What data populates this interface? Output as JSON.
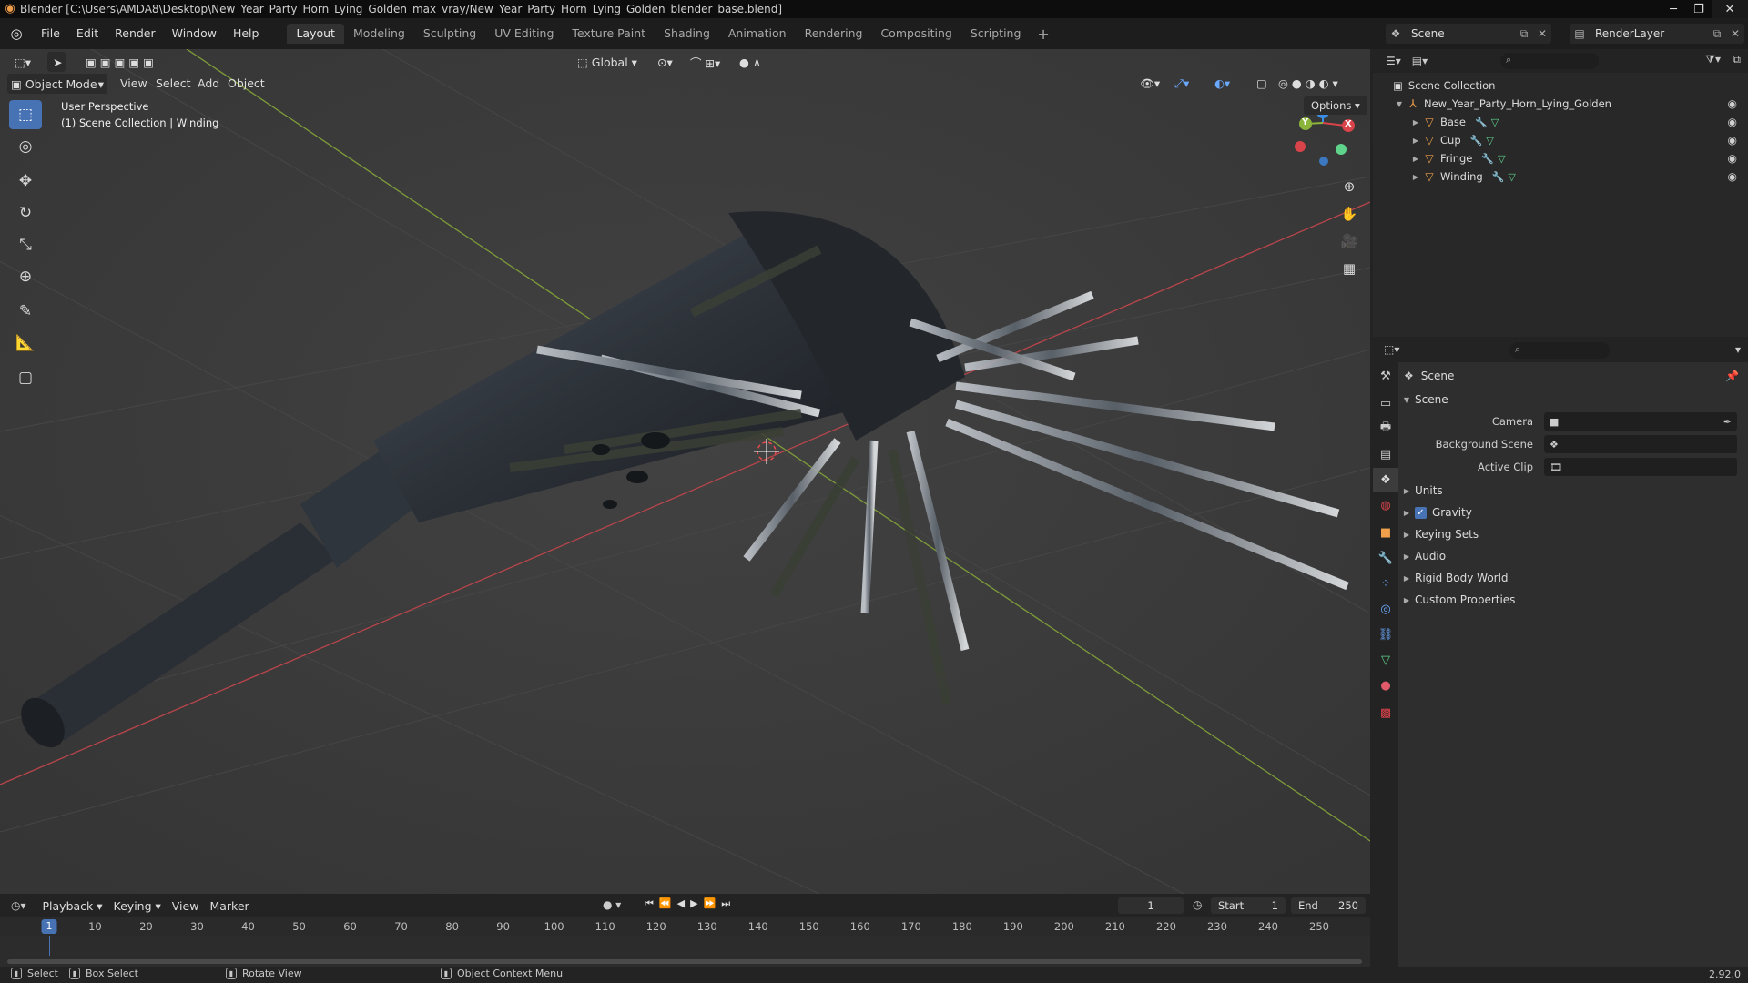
{
  "window": {
    "title": "Blender [C:\\Users\\AMDA8\\Desktop\\New_Year_Party_Horn_Lying_Golden_max_vray/New_Year_Party_Horn_Lying_Golden_blender_base.blend]"
  },
  "menubar": {
    "items": [
      "File",
      "Edit",
      "Render",
      "Window",
      "Help"
    ],
    "workspaces": [
      "Layout",
      "Modeling",
      "Sculpting",
      "UV Editing",
      "Texture Paint",
      "Shading",
      "Animation",
      "Rendering",
      "Compositing",
      "Scripting"
    ],
    "active_workspace": "Layout",
    "scene": "Scene",
    "view_layer": "RenderLayer"
  },
  "viewport": {
    "mode": "Object Mode",
    "menus": [
      "View",
      "Select",
      "Add",
      "Object"
    ],
    "transform_orientation": "Global",
    "options_label": "Options",
    "overlay_line1": "User Perspective",
    "overlay_line2": "(1) Scene Collection | Winding",
    "gizmo_axes": {
      "x": "X",
      "y": "Y",
      "z": "Z"
    }
  },
  "outliner": {
    "root": "Scene Collection",
    "collection": "New_Year_Party_Horn_Lying_Golden",
    "objects": [
      {
        "name": "Base"
      },
      {
        "name": "Cup"
      },
      {
        "name": "Fringe"
      },
      {
        "name": "Winding"
      }
    ]
  },
  "properties": {
    "context_title": "Scene",
    "panel_title": "Scene",
    "fields": [
      {
        "label": "Camera",
        "value": ""
      },
      {
        "label": "Background Scene",
        "value": ""
      },
      {
        "label": "Active Clip",
        "value": ""
      }
    ],
    "sections": [
      "Units",
      "Gravity",
      "Keying Sets",
      "Audio",
      "Rigid Body World",
      "Custom Properties"
    ],
    "gravity_checked": true
  },
  "timeline": {
    "menus": [
      "Playback",
      "Keying",
      "View",
      "Marker"
    ],
    "current_frame": "1",
    "start_label": "Start",
    "start_value": "1",
    "end_label": "End",
    "end_value": "250",
    "ruler_ticks": [
      "10",
      "20",
      "30",
      "40",
      "50",
      "60",
      "70",
      "80",
      "90",
      "100",
      "110",
      "120",
      "130",
      "140",
      "150",
      "160",
      "170",
      "180",
      "190",
      "200",
      "210",
      "220",
      "230",
      "240",
      "250"
    ],
    "playhead": "1"
  },
  "statusbar": {
    "select": "Select",
    "box_select": "Box Select",
    "rotate_view": "Rotate View",
    "context_menu": "Object Context Menu",
    "version": "2.92.0"
  },
  "colors": {
    "accent": "#4772b3",
    "object_orange": "#f0a04b",
    "x_axis": "#d9434a",
    "y_axis": "#8ab53a",
    "z_axis": "#3b8ee6"
  }
}
